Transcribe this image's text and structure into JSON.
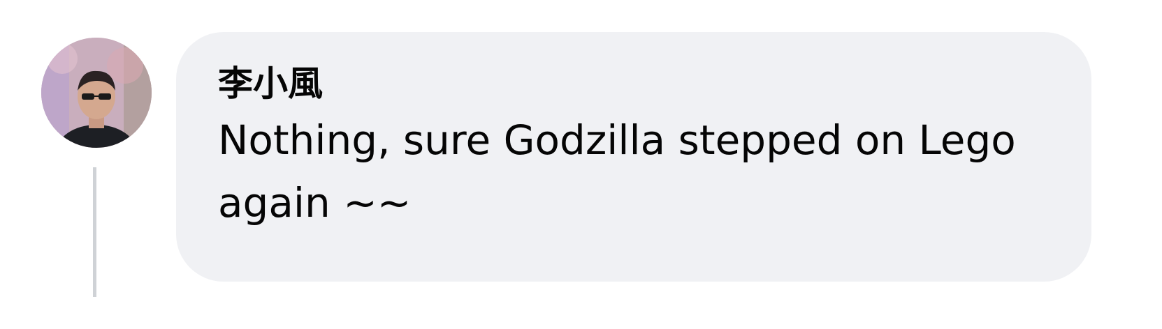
{
  "comment": {
    "author": "李小風",
    "text": "Nothing, sure Godzilla stepped on Lego again ~~"
  },
  "colors": {
    "bubble_background": "#f0f1f4",
    "text": "#050505",
    "thread_line": "#cfd2d6"
  }
}
